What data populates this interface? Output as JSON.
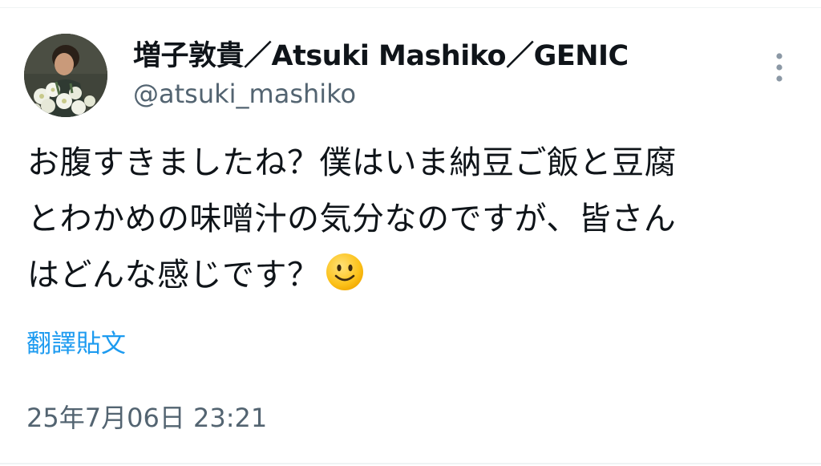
{
  "author": {
    "display_name": "増子敦貴／Atsuki Mashiko／GENIC",
    "handle": "@atsuki_mashiko",
    "avatar_icon": "profile-photo"
  },
  "more_icon": "more-vertical-icon",
  "tweet": {
    "lines": [
      "お腹すきましたね？僕はいま納豆ご飯と豆腐",
      "とわかめの味噌汁の気分なのですが、皆さん",
      "はどんな感じです？"
    ],
    "emoji": "slightly-smiling-face-emoji"
  },
  "translate_label": "翻譯貼文",
  "timestamp": "25年7月06日 23:21",
  "colors": {
    "text_primary": "#0f1419",
    "text_secondary": "#536471",
    "link": "#1d9bf0",
    "divider": "#eff3f4"
  }
}
